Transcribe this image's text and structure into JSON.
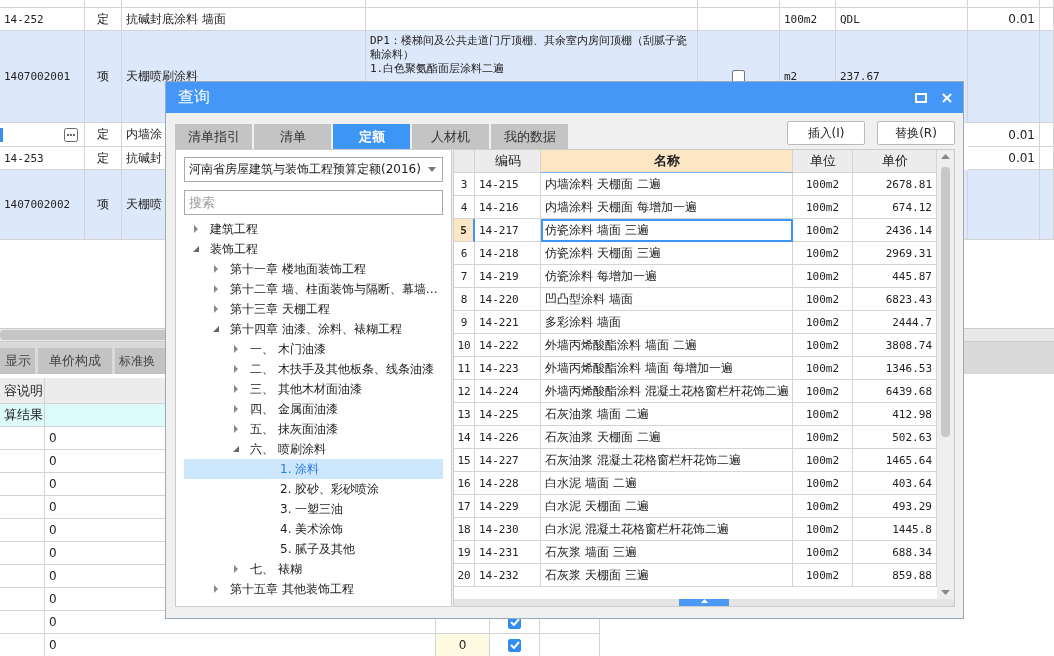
{
  "background_grid": {
    "rows": [
      {
        "kind": "sub",
        "code": "14-252",
        "type": "定",
        "name": "抗碱封底涂料 墙面",
        "unit": "100m2",
        "column_7": "QDL",
        "column_8": "0.01"
      },
      {
        "kind": "item",
        "code": "1407002001",
        "type": "项",
        "name": "天棚喷刷涂料",
        "description": [
          "DP1：楼梯间及公共走道门厅顶棚、其余室内房间顶棚（刮腻子瓷釉涂料）",
          "1.白色聚氨酯面层涂料二遍"
        ],
        "checked": false,
        "unit": "m2",
        "column_7": "237.67"
      },
      {
        "kind": "editing",
        "type": "定",
        "name": "内墙涂",
        "column_8": "0.01"
      },
      {
        "kind": "sub",
        "code": "14-253",
        "type": "定",
        "name": "抗碱封",
        "column_8": "0.01"
      },
      {
        "kind": "item",
        "code": "1407002002",
        "type": "项",
        "name": "天棚喷"
      }
    ]
  },
  "lower_tabs": [
    "显示",
    "单价构成",
    "标准换"
  ],
  "lower_grid": {
    "header": "容说明",
    "rows": [
      {
        "kind": "result",
        "label": "算结果"
      },
      {
        "kind": "value",
        "value": "0"
      },
      {
        "kind": "value",
        "value": "0"
      },
      {
        "kind": "value",
        "value": "0"
      },
      {
        "kind": "value",
        "value": "0"
      },
      {
        "kind": "value",
        "value": "0"
      },
      {
        "kind": "value",
        "value": "0"
      },
      {
        "kind": "value",
        "value": "0"
      },
      {
        "kind": "value",
        "value": "0"
      },
      {
        "kind": "value",
        "value": "0",
        "checked": true
      },
      {
        "kind": "value",
        "value": "0",
        "quantity": "0",
        "checked": true
      }
    ]
  },
  "dialog": {
    "title": "查询",
    "tabs": [
      {
        "label": "清单指引",
        "selected": false
      },
      {
        "label": "清单",
        "selected": false
      },
      {
        "label": "定额",
        "selected": true
      },
      {
        "label": "人材机",
        "selected": false
      },
      {
        "label": "我的数据",
        "selected": false
      }
    ],
    "buttons": [
      "插入(I)",
      "替换(R)"
    ],
    "library": "河南省房屋建筑与装饰工程预算定额(2016)",
    "search": {
      "placeholder": "搜索"
    },
    "tree": [
      {
        "label": "建筑工程",
        "expanded": false,
        "selected": false
      },
      {
        "label": "装饰工程",
        "expanded": true,
        "selected": false,
        "children": [
          {
            "label": "第十一章  楼地面装饰工程",
            "expanded": false,
            "selected": false
          },
          {
            "label": "第十二章  墙、柱面装饰与隔断、幕墙…",
            "expanded": false,
            "selected": false
          },
          {
            "label": "第十三章  天棚工程",
            "expanded": false,
            "selected": false
          },
          {
            "label": "第十四章  油漆、涂料、裱糊工程",
            "expanded": true,
            "selected": false,
            "children": [
              {
                "label": "一、  木门油漆",
                "expanded": false,
                "selected": false
              },
              {
                "label": "二、  木扶手及其他板条、线条油漆",
                "expanded": false,
                "selected": false
              },
              {
                "label": "三、  其他木材面油漆",
                "expanded": false,
                "selected": false
              },
              {
                "label": "四、  金属面油漆",
                "expanded": false,
                "selected": false
              },
              {
                "label": "五、  抹灰面油漆",
                "expanded": false,
                "selected": false
              },
              {
                "label": "六、  喷刷涂料",
                "expanded": true,
                "selected": false,
                "children": [
                  {
                    "label": "1. 涂料",
                    "selected": true
                  },
                  {
                    "label": "2. 胶砂、彩砂喷涂",
                    "selected": false
                  },
                  {
                    "label": "3. 一塑三油",
                    "selected": false
                  },
                  {
                    "label": "4. 美术涂饰",
                    "selected": false
                  },
                  {
                    "label": "5. 腻子及其他",
                    "selected": false
                  }
                ]
              },
              {
                "label": "七、  裱糊",
                "expanded": false,
                "selected": false
              }
            ]
          },
          {
            "label": "第十五章  其他装饰工程",
            "expanded": false,
            "selected": false
          }
        ]
      }
    ],
    "table": {
      "columns": [
        {
          "label": "编码",
          "selected": false
        },
        {
          "label": "名称",
          "selected": true
        },
        {
          "label": "单位",
          "selected": false
        },
        {
          "label": "单价",
          "selected": false
        }
      ],
      "rows": [
        {
          "index": "3",
          "code": "14-215",
          "name": "内墙涂料 天棚面 二遍",
          "unit": "100m2",
          "price": "2678.81",
          "selected": false
        },
        {
          "index": "4",
          "code": "14-216",
          "name": "内墙涂料 天棚面 每增加一遍",
          "unit": "100m2",
          "price": "674.12",
          "selected": false
        },
        {
          "index": "5",
          "code": "14-217",
          "name": "仿瓷涂料 墙面 三遍",
          "unit": "100m2",
          "price": "2436.14",
          "selected": true
        },
        {
          "index": "6",
          "code": "14-218",
          "name": "仿瓷涂料 天棚面 三遍",
          "unit": "100m2",
          "price": "2969.31",
          "selected": false
        },
        {
          "index": "7",
          "code": "14-219",
          "name": "仿瓷涂料 每增加一遍",
          "unit": "100m2",
          "price": "445.87",
          "selected": false
        },
        {
          "index": "8",
          "code": "14-220",
          "name": "凹凸型涂料 墙面",
          "unit": "100m2",
          "price": "6823.43",
          "selected": false
        },
        {
          "index": "9",
          "code": "14-221",
          "name": "多彩涂料 墙面",
          "unit": "100m2",
          "price": "2444.7",
          "selected": false
        },
        {
          "index": "10",
          "code": "14-222",
          "name": "外墙丙烯酸酯涂料 墙面 二遍",
          "unit": "100m2",
          "price": "3808.74",
          "selected": false
        },
        {
          "index": "11",
          "code": "14-223",
          "name": "外墙丙烯酸酯涂料 墙面 每增加一遍",
          "unit": "100m2",
          "price": "1346.53",
          "selected": false
        },
        {
          "index": "12",
          "code": "14-224",
          "name": "外墙丙烯酸酯涂料 混凝土花格窗栏杆花饰二遍",
          "unit": "100m2",
          "price": "6439.68",
          "selected": false
        },
        {
          "index": "13",
          "code": "14-225",
          "name": "石灰油浆 墙面 二遍",
          "unit": "100m2",
          "price": "412.98",
          "selected": false
        },
        {
          "index": "14",
          "code": "14-226",
          "name": "石灰油浆 天棚面 二遍",
          "unit": "100m2",
          "price": "502.63",
          "selected": false
        },
        {
          "index": "15",
          "code": "14-227",
          "name": "石灰油浆 混凝土花格窗栏杆花饰二遍",
          "unit": "100m2",
          "price": "1465.64",
          "selected": false
        },
        {
          "index": "16",
          "code": "14-228",
          "name": "白水泥 墙面 二遍",
          "unit": "100m2",
          "price": "403.64",
          "selected": false
        },
        {
          "index": "17",
          "code": "14-229",
          "name": "白水泥 天棚面 二遍",
          "unit": "100m2",
          "price": "493.29",
          "selected": false
        },
        {
          "index": "18",
          "code": "14-230",
          "name": "白水泥 混凝土花格窗栏杆花饰二遍",
          "unit": "100m2",
          "price": "1445.8",
          "selected": false
        },
        {
          "index": "19",
          "code": "14-231",
          "name": "石灰浆 墙面 三遍",
          "unit": "100m2",
          "price": "688.34",
          "selected": false
        },
        {
          "index": "20",
          "code": "14-232",
          "name": "石灰浆 天棚面 三遍",
          "unit": "100m2",
          "price": "859.88",
          "selected": false
        }
      ]
    }
  }
}
